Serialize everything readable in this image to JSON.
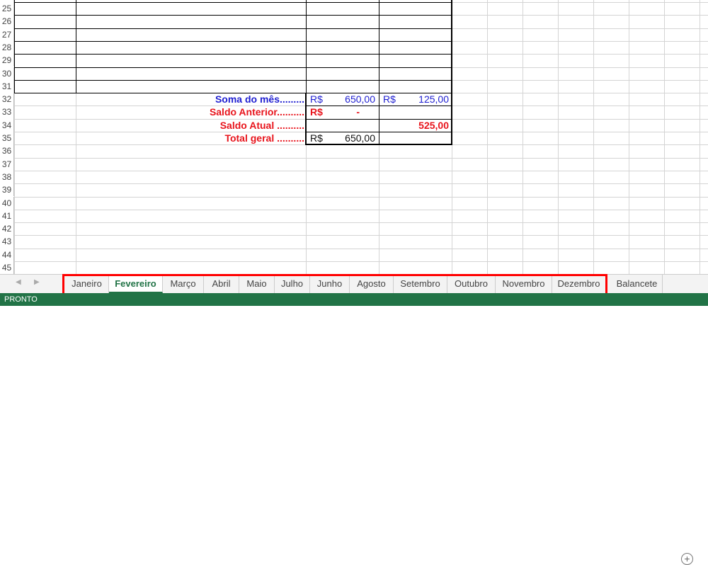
{
  "rows": [
    25,
    26,
    27,
    28,
    29,
    30,
    31,
    32,
    33,
    34,
    35,
    36,
    37,
    38,
    39,
    40,
    41,
    42,
    43,
    44,
    45
  ],
  "summary": [
    {
      "row": 32,
      "label": "Soma do mês.........",
      "label_color": "blue",
      "c_cur": "R$",
      "c_val": "650,00",
      "c_color": "blue",
      "d_cur": "R$",
      "d_val": "125,00",
      "d_color": "blue"
    },
    {
      "row": 33,
      "label": "Saldo Anterior..........",
      "label_color": "red",
      "c_cur": "R$",
      "c_val": "-",
      "c_color": "red",
      "c_bold": true,
      "d_cur": "",
      "d_val": "",
      "d_color": "red"
    },
    {
      "row": 34,
      "label": "Saldo Atual ..........",
      "label_color": "red",
      "c_cur": "",
      "c_val": "",
      "c_color": "red",
      "d_cur": "",
      "d_val": "525,00",
      "d_color": "red",
      "d_bold": true
    },
    {
      "row": 35,
      "label": "Total geral ..........",
      "label_color": "red",
      "c_cur": "R$",
      "c_val": "650,00",
      "c_color": "blk",
      "d_cur": "",
      "d_val": "",
      "d_color": "blk"
    }
  ],
  "tabs": [
    "Janeiro",
    "Fevereiro",
    "Março",
    "Abril",
    "Maio",
    "Julho",
    "Junho",
    "Agosto",
    "Setembro",
    "Outubro",
    "Novembro",
    "Dezembro",
    "Balancete"
  ],
  "active_tab": "Fevereiro",
  "nav": {
    "prev": "◀",
    "next": "▶"
  },
  "add_sheet": "+",
  "status": "PRONTO",
  "colors": {
    "accent": "#217346",
    "highlight": "#ff0000"
  }
}
